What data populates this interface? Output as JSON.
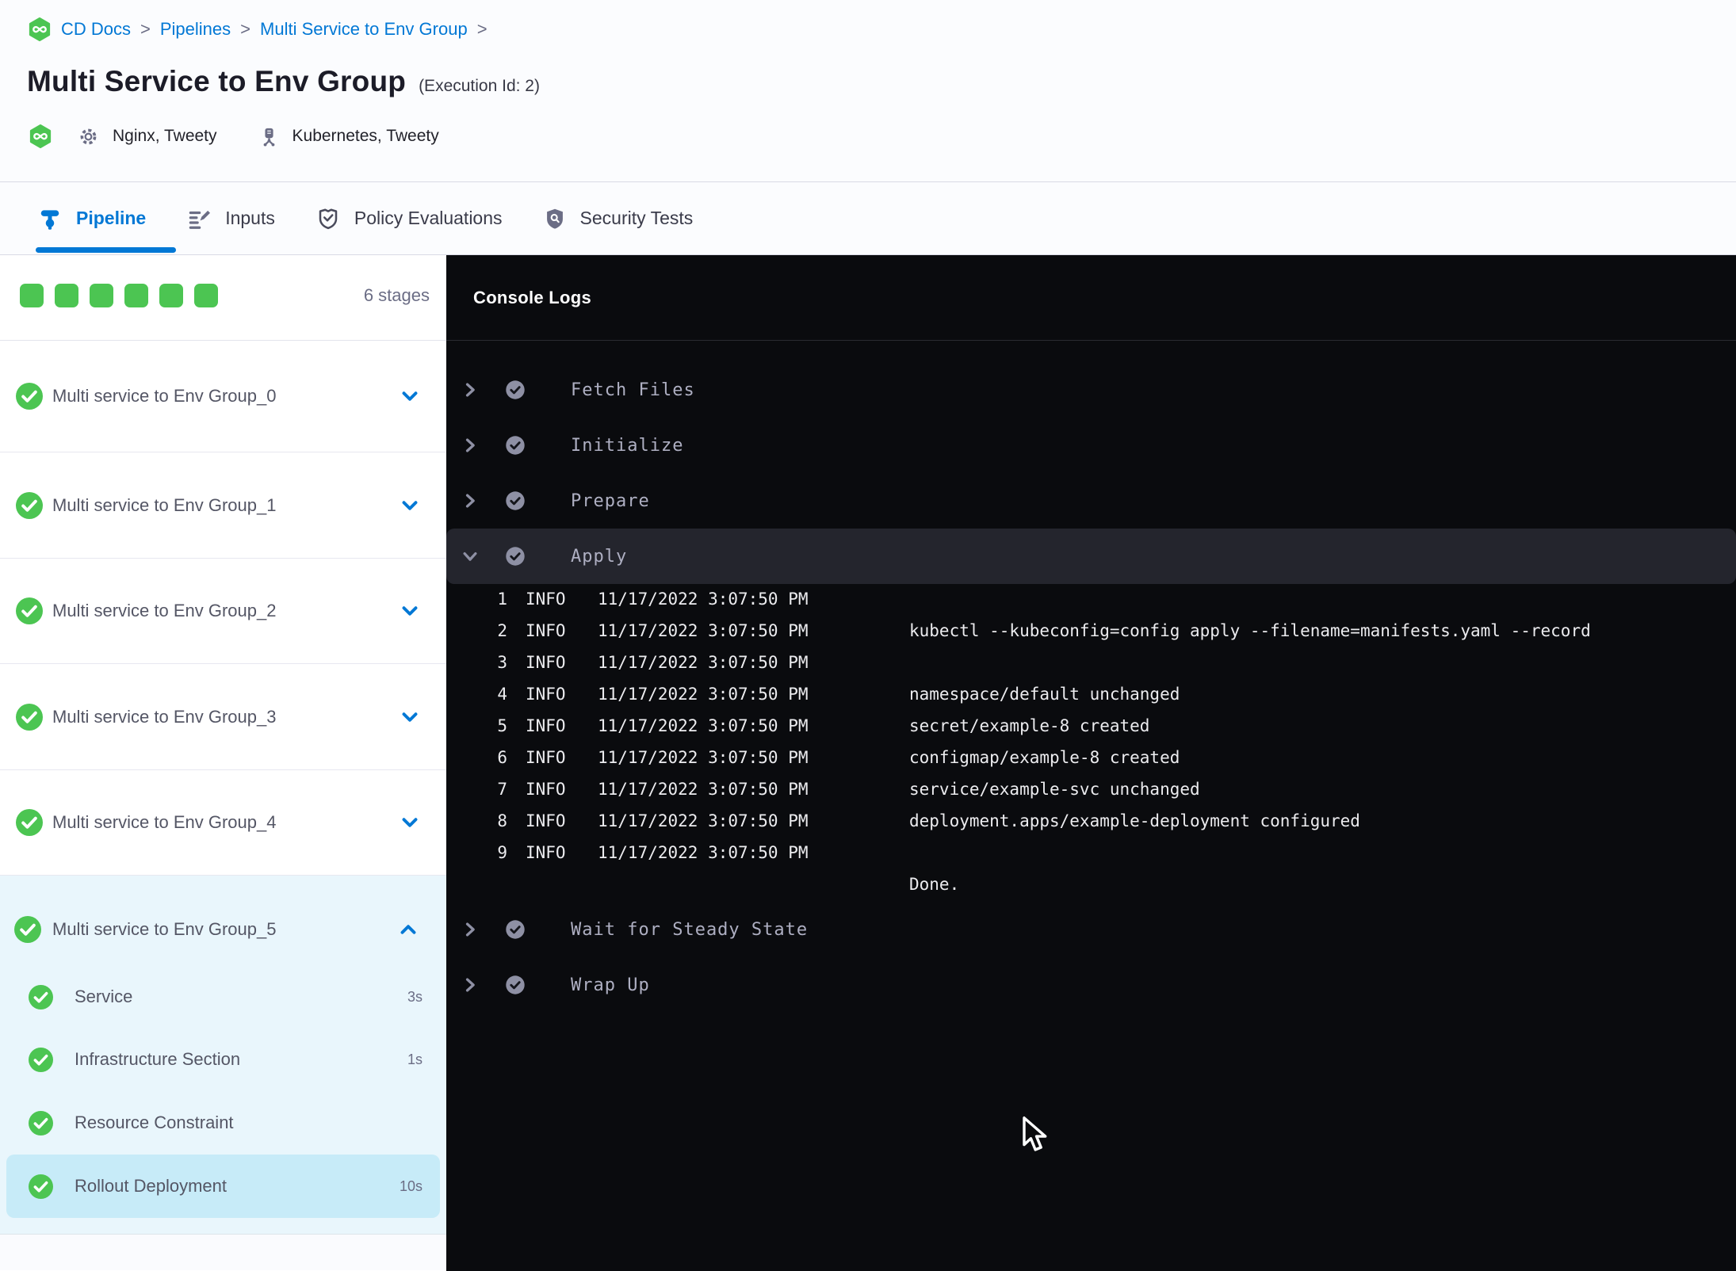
{
  "colors": {
    "accent-blue": "#0278D5",
    "success-green": "#4CC552",
    "console-bg": "#0A0B0E",
    "console-row-bg": "#24252D",
    "sidebar-expanded-bg": "#E9F6FC",
    "selected-step-bg": "#C7EBF8"
  },
  "breadcrumb": {
    "separator": ">",
    "items": [
      {
        "label": "CD Docs"
      },
      {
        "label": "Pipelines"
      },
      {
        "label": "Multi Service to Env Group"
      }
    ]
  },
  "header": {
    "title": "Multi Service to Env Group",
    "execution_id": "(Execution Id: 2)",
    "services_label": "Nginx, Tweety",
    "environments_label": "Kubernetes, Tweety"
  },
  "tabs": [
    {
      "label": "Pipeline",
      "active": true
    },
    {
      "label": "Inputs",
      "active": false
    },
    {
      "label": "Policy Evaluations",
      "active": false
    },
    {
      "label": "Security Tests",
      "active": false
    }
  ],
  "stages_panel": {
    "summary_label": "6 stages",
    "completed_squares": 6,
    "stages": [
      {
        "label": "Multi service to Env Group_0",
        "status": "success",
        "expanded": false
      },
      {
        "label": "Multi service to Env Group_1",
        "status": "success",
        "expanded": false
      },
      {
        "label": "Multi service to Env Group_2",
        "status": "success",
        "expanded": false
      },
      {
        "label": "Multi service to Env Group_3",
        "status": "success",
        "expanded": false
      },
      {
        "label": "Multi service to Env Group_4",
        "status": "success",
        "expanded": false
      },
      {
        "label": "Multi service to Env Group_5",
        "status": "success",
        "expanded": true,
        "steps": [
          {
            "label": "Service",
            "duration": "3s",
            "status": "success",
            "selected": false
          },
          {
            "label": "Infrastructure Section",
            "duration": "1s",
            "status": "success",
            "selected": false
          },
          {
            "label": "Resource Constraint",
            "duration": "",
            "status": "success",
            "selected": false
          },
          {
            "label": "Rollout Deployment",
            "duration": "10s",
            "status": "success",
            "selected": true
          }
        ]
      }
    ]
  },
  "console": {
    "title": "Console Logs",
    "steps": [
      {
        "label": "Fetch Files",
        "status": "success",
        "expanded": false
      },
      {
        "label": "Initialize",
        "status": "success",
        "expanded": false
      },
      {
        "label": "Prepare",
        "status": "success",
        "expanded": false
      },
      {
        "label": "Apply",
        "status": "success",
        "expanded": true
      },
      {
        "label": "Wait for Steady State",
        "status": "success",
        "expanded": false
      },
      {
        "label": "Wrap Up",
        "status": "success",
        "expanded": false
      }
    ],
    "logs": [
      {
        "n": "1",
        "level": "INFO",
        "time": "11/17/2022 3:07:50 PM",
        "message": ""
      },
      {
        "n": "2",
        "level": "INFO",
        "time": "11/17/2022 3:07:50 PM",
        "message": "kubectl --kubeconfig=config apply --filename=manifests.yaml --record"
      },
      {
        "n": "3",
        "level": "INFO",
        "time": "11/17/2022 3:07:50 PM",
        "message": ""
      },
      {
        "n": "4",
        "level": "INFO",
        "time": "11/17/2022 3:07:50 PM",
        "message": "namespace/default unchanged"
      },
      {
        "n": "5",
        "level": "INFO",
        "time": "11/17/2022 3:07:50 PM",
        "message": "secret/example-8 created"
      },
      {
        "n": "6",
        "level": "INFO",
        "time": "11/17/2022 3:07:50 PM",
        "message": "configmap/example-8 created"
      },
      {
        "n": "7",
        "level": "INFO",
        "time": "11/17/2022 3:07:50 PM",
        "message": "service/example-svc unchanged"
      },
      {
        "n": "8",
        "level": "INFO",
        "time": "11/17/2022 3:07:50 PM",
        "message": "deployment.apps/example-deployment configured"
      },
      {
        "n": "9",
        "level": "INFO",
        "time": "11/17/2022 3:07:50 PM",
        "message": ""
      },
      {
        "n": "",
        "level": "",
        "time": "",
        "message": "Done."
      }
    ]
  }
}
